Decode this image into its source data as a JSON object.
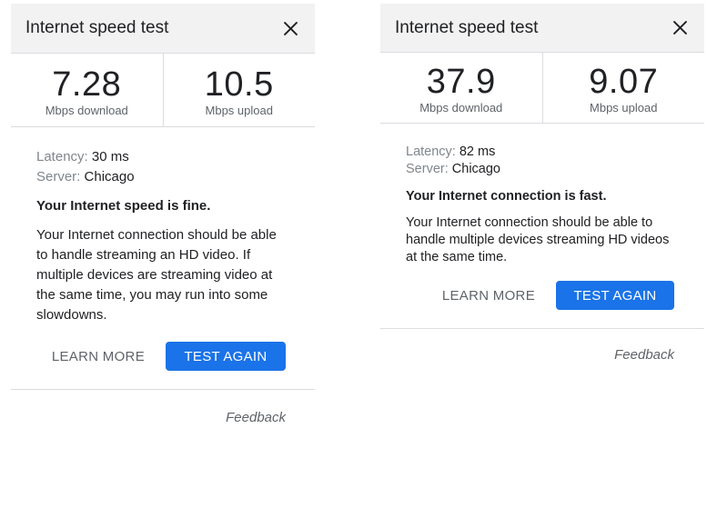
{
  "panels": [
    {
      "title": "Internet speed test",
      "download": {
        "value": "7.28",
        "label": "Mbps download"
      },
      "upload": {
        "value": "10.5",
        "label": "Mbps upload"
      },
      "latency": {
        "label": "Latency:",
        "value": "30 ms"
      },
      "server": {
        "label": "Server:",
        "value": "Chicago"
      },
      "headline": "Your Internet speed is fine.",
      "description": "Your Internet connection should be able to handle streaming an HD video. If multiple devices are streaming video at the same time, you may run into some slowdowns.",
      "learn_more": "LEARN MORE",
      "test_again": "TEST AGAIN",
      "feedback": "Feedback"
    },
    {
      "title": "Internet speed test",
      "download": {
        "value": "37.9",
        "label": "Mbps download"
      },
      "upload": {
        "value": "9.07",
        "label": "Mbps upload"
      },
      "latency": {
        "label": "Latency:",
        "value": "82 ms"
      },
      "server": {
        "label": "Server:",
        "value": "Chicago"
      },
      "headline": "Your Internet connection is fast.",
      "description": "Your Internet connection should be able to handle multiple devices streaming HD videos at the same time.",
      "learn_more": "LEARN MORE",
      "test_again": "TEST AGAIN",
      "feedback": "Feedback"
    }
  ],
  "icons": {
    "close": "close-icon"
  },
  "colors": {
    "primary": "#1a73e8",
    "header_bg": "#f2f2f2",
    "divider": "#dadce0"
  }
}
